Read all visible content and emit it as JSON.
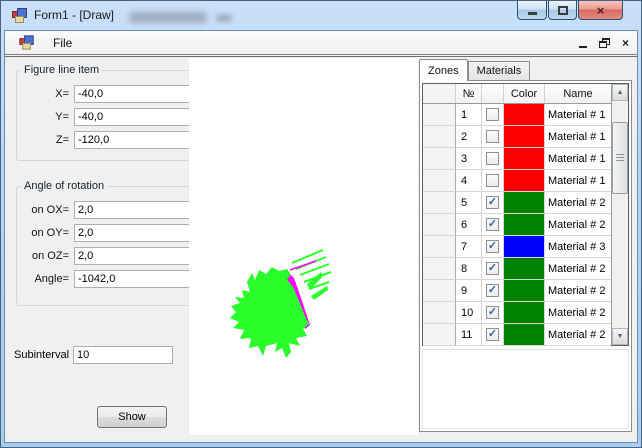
{
  "window": {
    "title": "Form1 - [Draw]"
  },
  "titlebar": {
    "buttons": [
      {
        "name": "minimize"
      },
      {
        "name": "maximize"
      },
      {
        "name": "close"
      }
    ]
  },
  "menu": {
    "items": [
      "File"
    ]
  },
  "left_panel": {
    "figure_group": {
      "title": "Figure line item",
      "fields": [
        {
          "label": "X=",
          "value": "-40,0"
        },
        {
          "label": "Y=",
          "value": "-40,0"
        },
        {
          "label": "Z=",
          "value": "-120,0"
        }
      ]
    },
    "angle_group": {
      "title": "Angle of rotation",
      "fields": [
        {
          "label": "on OX=",
          "value": "2,0"
        },
        {
          "label": "on OY=",
          "value": "2,0"
        },
        {
          "label": "on OZ=",
          "value": "2,0"
        },
        {
          "label": "Angle=",
          "value": "-1042,0"
        }
      ]
    },
    "subinterval": {
      "label": "Subinterval",
      "value": "10"
    },
    "show_button": "Show"
  },
  "tabs": [
    {
      "label": "Zones",
      "active": true
    },
    {
      "label": "Materials",
      "active": false
    }
  ],
  "grid": {
    "columns": [
      "",
      "№",
      "",
      "Color",
      "Name"
    ],
    "rows": [
      {
        "num": "1",
        "checked": false,
        "color": "#FF0000",
        "name": "Material # 1"
      },
      {
        "num": "2",
        "checked": false,
        "color": "#FF0000",
        "name": "Material # 1"
      },
      {
        "num": "3",
        "checked": false,
        "color": "#FF0000",
        "name": "Material # 1"
      },
      {
        "num": "4",
        "checked": false,
        "color": "#FF0000",
        "name": "Material # 1"
      },
      {
        "num": "5",
        "checked": true,
        "color": "#008000",
        "name": "Material # 2"
      },
      {
        "num": "6",
        "checked": true,
        "color": "#008000",
        "name": "Material # 2"
      },
      {
        "num": "7",
        "checked": true,
        "color": "#0000FF",
        "name": "Material # 3"
      },
      {
        "num": "8",
        "checked": true,
        "color": "#008000",
        "name": "Material # 2"
      },
      {
        "num": "9",
        "checked": true,
        "color": "#008000",
        "name": "Material # 2"
      },
      {
        "num": "10",
        "checked": true,
        "color": "#008000",
        "name": "Material # 2"
      },
      {
        "num": "11",
        "checked": true,
        "color": "#008000",
        "name": "Material # 2"
      }
    ]
  },
  "icons": {
    "check": "✓",
    "scroll_up": "▲",
    "scroll_down": "▼",
    "close": "×"
  },
  "colors": {
    "titlebar_blue": "#b4d5f6",
    "figure_green": "#2bff2b",
    "figure_magenta": "#ff00ff",
    "material_red": "#FF0000",
    "material_green": "#008000",
    "material_blue": "#0000FF"
  }
}
